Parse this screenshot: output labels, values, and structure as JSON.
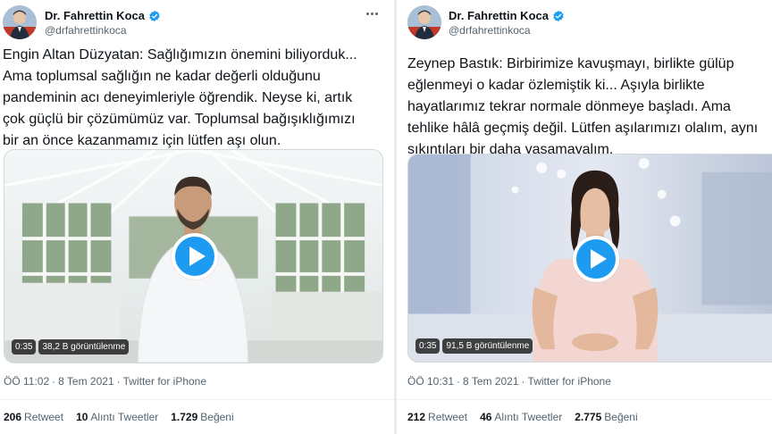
{
  "tweets": [
    {
      "author": {
        "display_name": "Dr. Fahrettin Koca",
        "handle": "@drfahrettinkoca",
        "verified": true
      },
      "text": "Engin Altan Düzyatan: Sağlığımızın önemini biliyorduk...\nAma toplumsal sağlığın ne kadar değerli olduğunu\npandeminin acı deneyimleriyle öğrendik. Neyse ki, artık\nçok güçlü bir çözümümüz var. Toplumsal bağışıklığımızı\nbir an önce kazanmamız için lütfen aşı olun.",
      "video": {
        "duration": "0:35",
        "views": "38,2 B görüntülenme"
      },
      "meta": {
        "time": "ÖÖ 11:02",
        "date": "8 Tem 2021",
        "source": "Twitter for iPhone"
      },
      "stats": {
        "retweets": "206",
        "retweets_label": "Retweet",
        "quotes": "10",
        "quotes_label": "Alıntı Tweetler",
        "likes": "1.729",
        "likes_label": "Beğeni"
      }
    },
    {
      "author": {
        "display_name": "Dr. Fahrettin Koca",
        "handle": "@drfahrettinkoca",
        "verified": true
      },
      "text": "Zeynep Bastık: Birbirimize kavuşmayı, birlikte gülüp\neğlenmeyi o kadar özlemiştik ki... Aşıyla birlikte\nhayatlarımız tekrar normale dönmeye başladı. Ama\ntehlike hâlâ geçmiş değil. Lütfen aşılarımızı olalım, aynı\nsıkıntıları bir daha yaşamayalım.",
      "video": {
        "duration": "0:35",
        "views": "91,5 B görüntülenme"
      },
      "meta": {
        "time": "ÖÖ 10:31",
        "date": "8 Tem 2021",
        "source": "Twitter for iPhone"
      },
      "stats": {
        "retweets": "212",
        "retweets_label": "Retweet",
        "quotes": "46",
        "quotes_label": "Alıntı Tweetler",
        "likes": "2.775",
        "likes_label": "Beğeni"
      }
    }
  ],
  "colors": {
    "accent": "#1d9bf0",
    "text": "#0f1419",
    "secondary": "#536471"
  }
}
